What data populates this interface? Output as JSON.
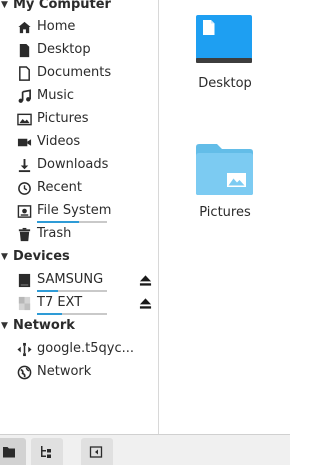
{
  "sidebar": {
    "sections": {
      "my_computer": "My Computer",
      "devices": "Devices",
      "network": "Network"
    },
    "places": [
      {
        "label": "Home",
        "icon": "home-icon"
      },
      {
        "label": "Desktop",
        "icon": "desktop-icon"
      },
      {
        "label": "Documents",
        "icon": "documents-icon"
      },
      {
        "label": "Music",
        "icon": "music-icon"
      },
      {
        "label": "Pictures",
        "icon": "pictures-icon"
      },
      {
        "label": "Videos",
        "icon": "videos-icon"
      },
      {
        "label": "Downloads",
        "icon": "downloads-icon"
      },
      {
        "label": "Recent",
        "icon": "recent-icon"
      },
      {
        "label": "File System",
        "icon": "drive-icon",
        "usage_fraction": 0.6
      },
      {
        "label": "Trash",
        "icon": "trash-icon"
      }
    ],
    "devices": [
      {
        "label": "SAMSUNG",
        "icon": "usb-drive-icon",
        "usage_fraction": 0.3,
        "eject": "eject-icon"
      },
      {
        "label": "T7 EXT",
        "icon": "usb-drive-icon",
        "usage_fraction": 0.35,
        "eject": "eject-icon"
      }
    ],
    "network": [
      {
        "label": "google.t5qyc...",
        "icon": "network-share-icon"
      },
      {
        "label": "Network",
        "icon": "network-icon"
      }
    ]
  },
  "main": {
    "items": [
      {
        "name": "Desktop",
        "icon": "desktop-folder-icon"
      },
      {
        "name": "Pictures",
        "icon": "pictures-folder-icon"
      }
    ]
  },
  "bottombar": {
    "buttons": [
      "places-toggle-icon",
      "tree-view-icon",
      "close-sidebar-icon"
    ]
  },
  "colors": {
    "accent": "#2e9bd6",
    "folder_desktop": "#1e9ff2",
    "folder_pictures": "#7ccbf2",
    "usage_track": "#c9c9c9"
  }
}
